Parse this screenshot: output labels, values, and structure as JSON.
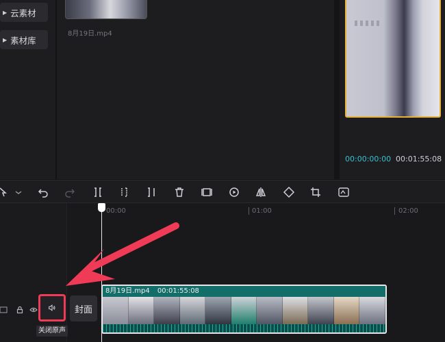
{
  "sidebar": {
    "items": [
      {
        "label": "云素材"
      },
      {
        "label": "素材库"
      }
    ]
  },
  "media": {
    "filename": "8月19日.mp4"
  },
  "preview": {
    "current_time": "00:00:00:00",
    "total_time": "00:01:55:08"
  },
  "toolbar": {
    "tools": [
      "cursor-icon",
      "chevron-down-icon",
      "undo-icon",
      "redo-icon",
      "split-icon",
      "split-left-icon",
      "split-right-icon",
      "delete-icon",
      "freeze-icon",
      "play-reverse-icon",
      "mirror-icon",
      "rotate-icon",
      "crop-icon",
      "audio-separate-icon"
    ]
  },
  "timeline": {
    "ruler": [
      "00:00",
      "01:00",
      "02:00"
    ],
    "clip": {
      "name": "8月19日.mp4",
      "duration": "00:01:55:08"
    },
    "audio_tooltip": "关闭原声",
    "cover_label": "封面"
  },
  "colors": {
    "accent_teal": "#39c0cf",
    "selection_gold": "#e6b23a",
    "highlight_red": "#ef3b56",
    "clip_teal": "#0d5f5c"
  }
}
